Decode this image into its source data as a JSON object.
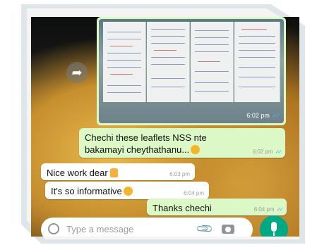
{
  "chat": {
    "image_message": {
      "time": "6:02 pm"
    },
    "messages": [
      {
        "direction": "out",
        "text_line1": "Chechi these leaflets NSS nte",
        "text_line2": "bakamayi cheythathanu...",
        "emoji": "smiling-face-emoji",
        "time": "6:02 pm"
      },
      {
        "direction": "in",
        "text": "Nice work dear",
        "emoji": "thumbs-up-emoji",
        "time": "6:03 pm"
      },
      {
        "direction": "in",
        "text": "It's so informative",
        "emoji": "smiling-face-emoji",
        "time": "6:04 pm"
      },
      {
        "direction": "out",
        "text": "Thanks chechi",
        "time": "6:04 pm"
      }
    ]
  },
  "composer": {
    "placeholder": "Type a message"
  },
  "colors": {
    "outgoing": "#dcf8c6",
    "incoming": "#ffffff",
    "accent": "#00a884",
    "read_tick": "#4fb6ec"
  }
}
